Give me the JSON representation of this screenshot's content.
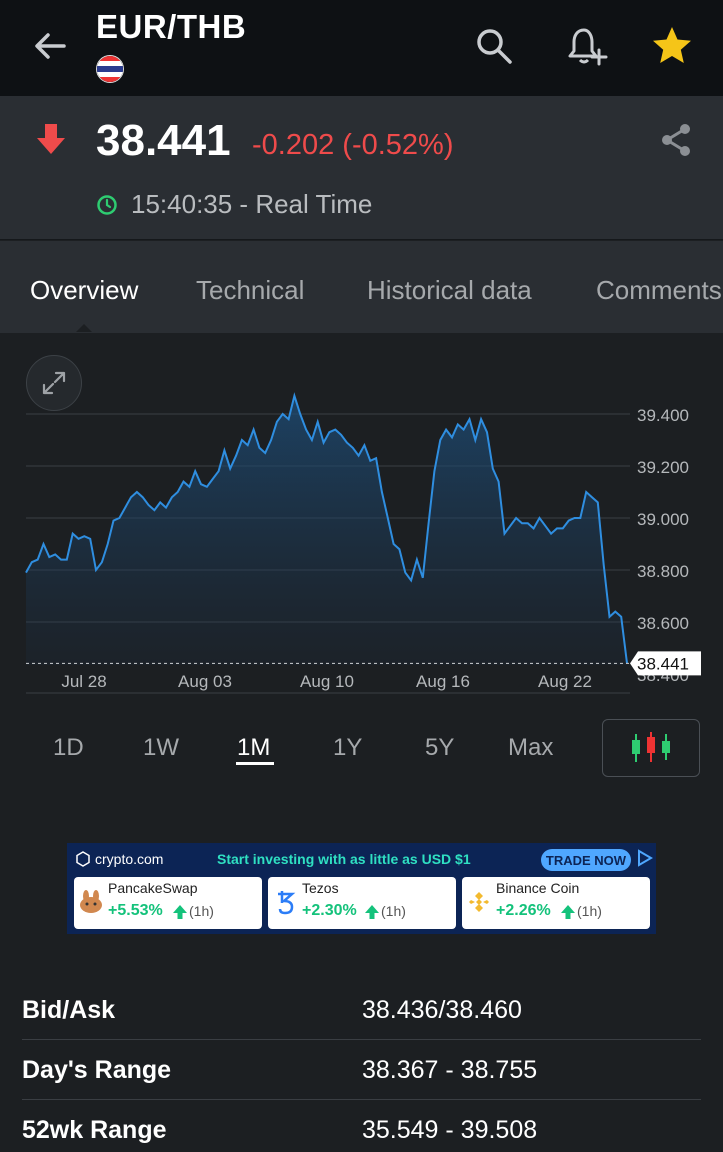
{
  "header": {
    "pair": "EUR/THB",
    "favorite_color": "#f5c518"
  },
  "quote": {
    "price": "38.441",
    "change": "-0.202 (-0.52%)",
    "time": "15:40:35 - Real Time",
    "down_color": "#ef4b4b",
    "live_color": "#2ecc71"
  },
  "tabs": [
    "Overview",
    "Technical",
    "Historical data",
    "Comments"
  ],
  "chart_data": {
    "type": "area",
    "y_ticks": [
      "39.400",
      "39.200",
      "39.000",
      "38.800",
      "38.600",
      "38.400"
    ],
    "x_ticks": [
      "Jul 28",
      "Aug 03",
      "Aug 10",
      "Aug 16",
      "Aug 22"
    ],
    "ylim": [
      38.4,
      39.55
    ],
    "last_value_label": "38.441",
    "last_value": 38.441,
    "line_color": "#2f8ee0",
    "values": [
      38.79,
      38.83,
      38.84,
      38.9,
      38.85,
      38.86,
      38.84,
      38.84,
      38.94,
      38.92,
      38.93,
      38.92,
      38.8,
      38.83,
      38.9,
      38.99,
      39.0,
      39.04,
      39.08,
      39.1,
      39.08,
      39.05,
      39.03,
      39.06,
      39.04,
      39.08,
      39.1,
      39.14,
      39.12,
      39.18,
      39.13,
      39.12,
      39.15,
      39.18,
      39.26,
      39.19,
      39.24,
      39.3,
      39.28,
      39.34,
      39.27,
      39.25,
      39.3,
      39.37,
      39.4,
      39.38,
      39.47,
      39.4,
      39.34,
      39.3,
      39.37,
      39.29,
      39.33,
      39.34,
      39.32,
      39.29,
      39.27,
      39.24,
      39.28,
      39.22,
      39.23,
      39.1,
      39.0,
      38.9,
      38.88,
      38.79,
      38.76,
      38.84,
      38.77,
      38.98,
      39.18,
      39.3,
      39.34,
      39.31,
      39.36,
      39.34,
      39.38,
      39.3,
      39.38,
      39.33,
      39.19,
      39.14,
      38.94,
      38.97,
      39.0,
      38.98,
      38.98,
      38.96,
      39.0,
      38.97,
      38.94,
      38.96,
      38.96,
      38.99,
      39.0,
      39.0,
      39.1,
      39.08,
      39.06,
      38.82,
      38.62,
      38.64,
      38.62,
      38.441
    ]
  },
  "ranges": [
    "1D",
    "1W",
    "1M",
    "1Y",
    "5Y",
    "Max"
  ],
  "ad": {
    "brand": "crypto.com",
    "tagline": "Start investing with as little as USD $1",
    "cta": "TRADE NOW",
    "coins": [
      {
        "name": "PancakeSwap",
        "pct": "+5.53%",
        "period": "(1h)"
      },
      {
        "name": "Tezos",
        "pct": "+2.30%",
        "period": "(1h)"
      },
      {
        "name": "Binance Coin",
        "pct": "+2.26%",
        "period": "(1h)"
      }
    ]
  },
  "stats": [
    {
      "label": "Bid/Ask",
      "value": "38.436/38.460"
    },
    {
      "label": "Day's Range",
      "value": "38.367 - 38.755"
    },
    {
      "label": "52wk Range",
      "value": "35.549 - 39.508"
    }
  ]
}
